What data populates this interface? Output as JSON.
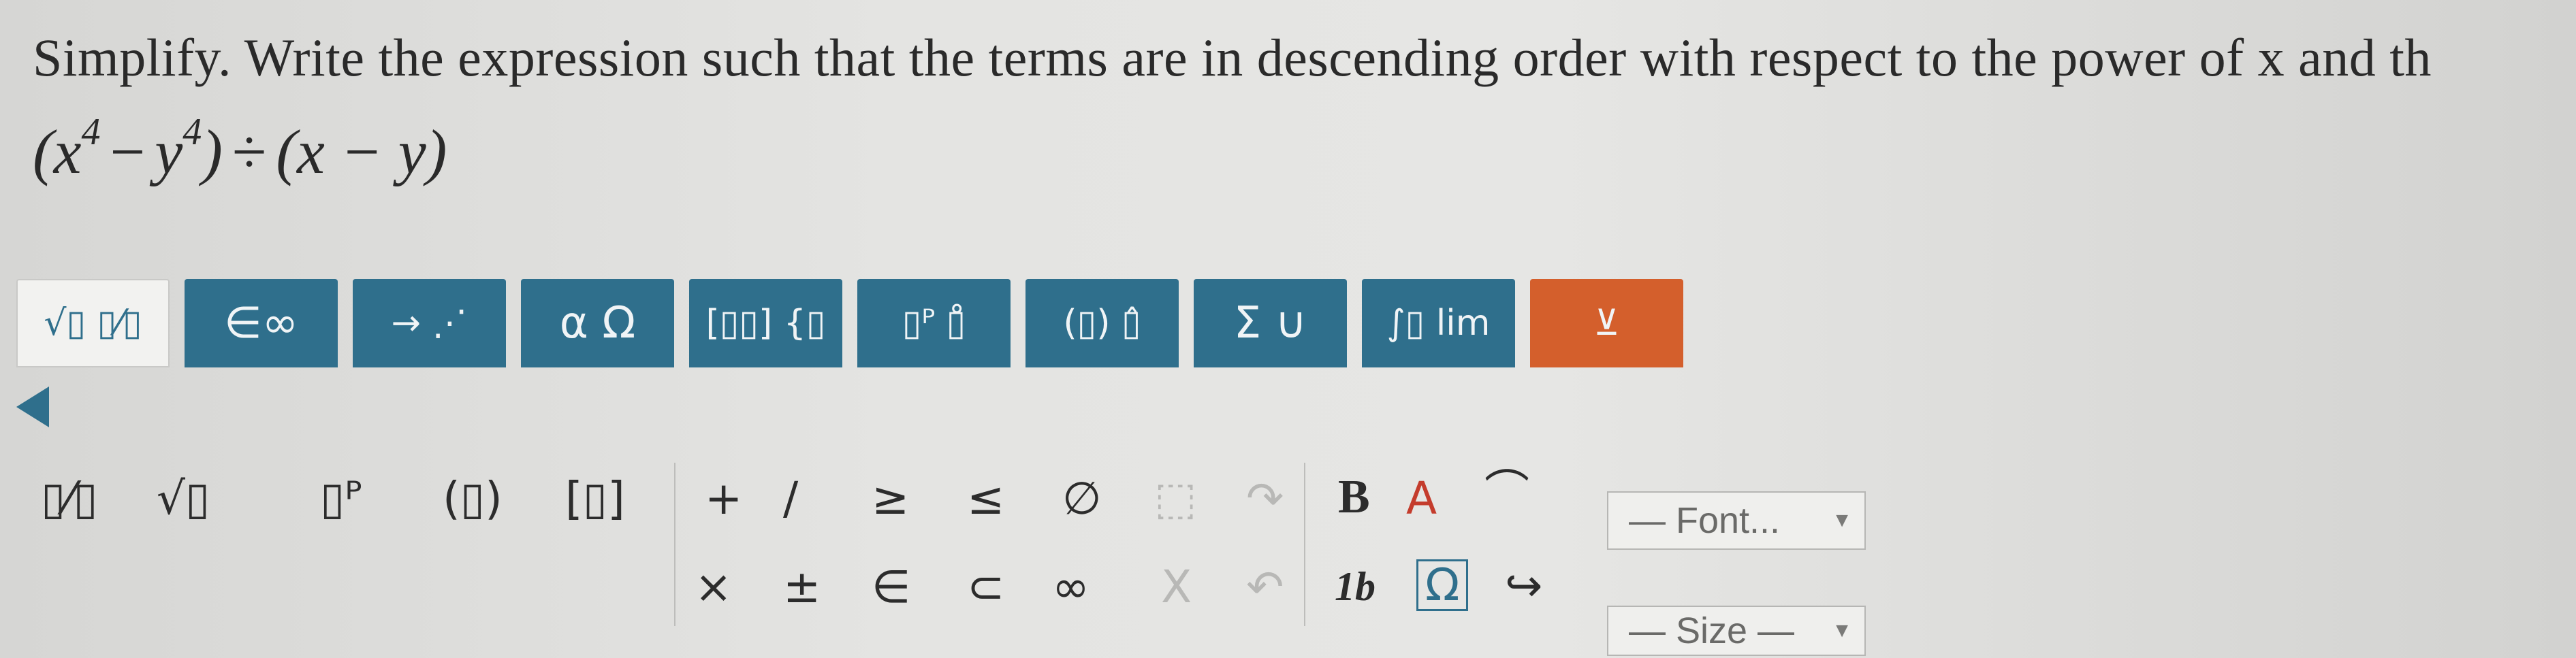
{
  "question": {
    "prompt": "Simplify. Write the expression such that the terms are in descending order with respect to the power of x and th",
    "expr_base1": "(x",
    "expr_exp1": "4",
    "expr_minus": "−",
    "expr_base2": "y",
    "expr_exp2": "4",
    "expr_close": ")",
    "expr_div": "÷",
    "expr_tail": "(x − y)"
  },
  "palette_tabs": [
    {
      "label": "√▯ ▯⁄▯"
    },
    {
      "label": "∈∞"
    },
    {
      "label": "→ ⋰"
    },
    {
      "label": "α Ω"
    },
    {
      "label": "[▯▯] {▯"
    },
    {
      "label": "▯ᴾ ▯̊"
    },
    {
      "label": "(▯) ▯̂"
    },
    {
      "label": "Σ ∪"
    },
    {
      "label": "∫▯ lim"
    },
    {
      "label": "⊻"
    }
  ],
  "symbols_row1": {
    "fraction": "▯⁄▯",
    "sqrt": "√▯",
    "power": "▯ᴾ",
    "parens": "(▯)",
    "brackets": "[▯]",
    "plus": "+",
    "slash": "/",
    "geq": "≥",
    "leq": "≤",
    "emptyset": "∅",
    "undo_disabled": "⬚",
    "redo_disabled": "↷",
    "bold": "B",
    "color": "A",
    "arrow_over": "⌒"
  },
  "symbols_row2": {
    "times": "×",
    "plusminus": "±",
    "elementof": "∈",
    "subset": "⊂",
    "infinity": "∞",
    "cut_disabled": "X",
    "redo2_disabled": "↶",
    "italic_one_b": "1b",
    "omega_box": "Ω",
    "link": "↪"
  },
  "dropdowns": {
    "font": "— Font...",
    "size": "— Size —"
  }
}
